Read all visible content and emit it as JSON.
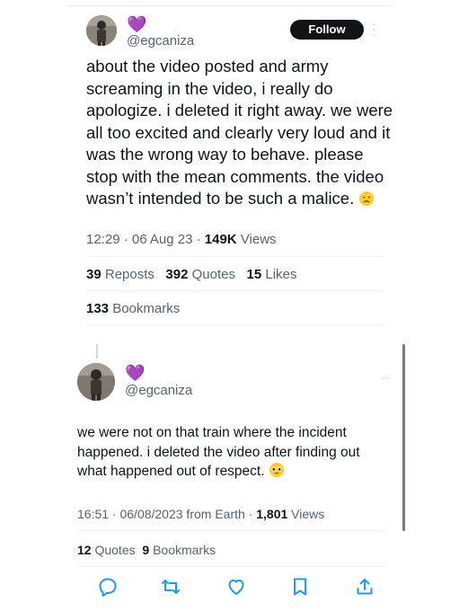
{
  "tweet1": {
    "handle": "@egcaniza",
    "badge": "💜",
    "follow_label": "Follow",
    "text": "about the video posted and army screaming in the video, i really do apologize. i deleted it right away. we were all too excited and clearly very loud and it was the wrong way to behave. please stop with the mean comments. the video wasn’t intended to be such a malice.",
    "emoji": "😞",
    "time": "12:29 · 06 Aug 23 · ",
    "views_count": "149K",
    "views_label": " Views",
    "reposts_count": "39",
    "reposts_label": "Reposts",
    "quotes_count": "392",
    "quotes_label": "Quotes",
    "likes_count": "15",
    "likes_label": "Likes",
    "bookmarks_count": "133",
    "bookmarks_label": "Bookmarks"
  },
  "tweet2": {
    "handle": "@egcaniza",
    "badge": "💜",
    "text": "we were not on that train where the incident happened. i deleted the video after finding out what happened out of respect.",
    "emoji": "🥺",
    "time": "16:51 · 06/08/2023 from Earth · ",
    "views_count": "1,801",
    "views_label": " Views",
    "quotes_count": "12",
    "quotes_label": "Quotes",
    "bookmarks_count": "9",
    "bookmarks_label": "Bookmarks"
  },
  "actions": [
    "reply-icon",
    "repost-icon",
    "like-icon",
    "bookmark-icon",
    "share-icon"
  ],
  "colors": {
    "accent": "#1d9bf0",
    "heart": "#8a2be2",
    "muted": "#536471"
  }
}
